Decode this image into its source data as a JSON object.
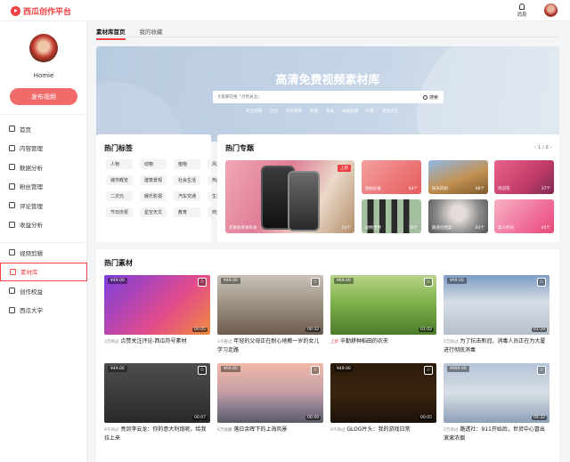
{
  "header": {
    "logo_text": "西瓜创作平台",
    "message_label": "消息"
  },
  "sidebar": {
    "username": "Homie",
    "publish_button": "发布视频",
    "group1": [
      {
        "label": "首页",
        "icon": "home-icon"
      },
      {
        "label": "内容管理",
        "icon": "video-icon"
      },
      {
        "label": "数据分析",
        "icon": "chart-icon"
      },
      {
        "label": "粉丝管理",
        "icon": "user-icon"
      },
      {
        "label": "评论管理",
        "icon": "comment-icon"
      },
      {
        "label": "收益分析",
        "icon": "money-icon"
      }
    ],
    "group2": [
      {
        "label": "视频剪辑",
        "icon": "scissors-icon"
      },
      {
        "label": "素材库",
        "icon": "library-icon",
        "active": true
      },
      {
        "label": "创作权益",
        "icon": "gift-icon"
      },
      {
        "label": "西瓜大学",
        "icon": "school-icon"
      }
    ]
  },
  "tabs": [
    {
      "label": "素材库首页",
      "active": true
    },
    {
      "label": "我的收藏",
      "active": false
    }
  ],
  "banner": {
    "title": "高清免费视频素材库",
    "search_placeholder": "大家都在搜「点赞关注」",
    "search_button": "搜索",
    "hot_words": [
      "新冠疫情",
      "古风",
      "城市夜景",
      "航拍",
      "美食",
      "悬疑惊魂",
      "片尾",
      "星际太空"
    ]
  },
  "hot_tags": {
    "title": "热门标签",
    "tags": [
      "人物",
      "动物",
      "植物",
      "风景",
      "城市概览",
      "建筑景观",
      "社会生活",
      "热门游戏",
      "二次元",
      "娱乐影视",
      "汽车交通",
      "生活家",
      "节日庆祝",
      "星空天文",
      "教育",
      "商业财经"
    ]
  },
  "hot_topics": {
    "title": "热门专题",
    "pager": "1 / 6",
    "topics": [
      {
        "label": "苹果秋季发布会",
        "count": "52个",
        "badge": "上新"
      },
      {
        "label": "涨粉必备",
        "count": "64个"
      },
      {
        "label": "秋天的树",
        "count": "88个"
      },
      {
        "label": "鸡冠花",
        "count": "37个"
      },
      {
        "label": "动物世界",
        "count": "76个"
      },
      {
        "label": "路透社档案",
        "count": "93个"
      },
      {
        "label": "美人时光",
        "count": "45个"
      }
    ]
  },
  "hot_material": {
    "title": "热门素材",
    "videos": [
      {
        "price": "¥49.00",
        "duration": "00:05",
        "pre": "3万商过",
        "title": "点赞关注评论-西瓜符号素材"
      },
      {
        "price": "¥49.00",
        "duration": "00:32",
        "pre": "1千看过",
        "title": "年轻的父母正在耐心地教一岁的女儿学习走路"
      },
      {
        "price": "¥69.00",
        "duration": "01:02",
        "pre": "上新",
        "pre_red": true,
        "title": "辛勤耕种稻田的农夫"
      },
      {
        "price": "¥99.00",
        "duration": "01:29",
        "pre": "5万商过",
        "title": "为了抗击新冠，消毒人员正在为大厦进行彻底消毒"
      },
      {
        "price": "¥49.00",
        "duration": "00:07",
        "pre": "9千商过",
        "title": "亮剑李云龙：你的意大利炮呢，给我拉上来"
      },
      {
        "price": "¥69.00",
        "duration": "00:49",
        "pre": "6万收藏",
        "title": "落日余晖下的上海风景"
      },
      {
        "price": "¥49.00",
        "duration": "00:05",
        "pre": "9千商过",
        "title": "GLOG片头：我的游戏日常"
      },
      {
        "price": "¥999.00",
        "duration": "04:32",
        "pre": "2万商过",
        "title": "路透社：911开始后，世贸中心冒出滚滚浓烟"
      }
    ]
  }
}
